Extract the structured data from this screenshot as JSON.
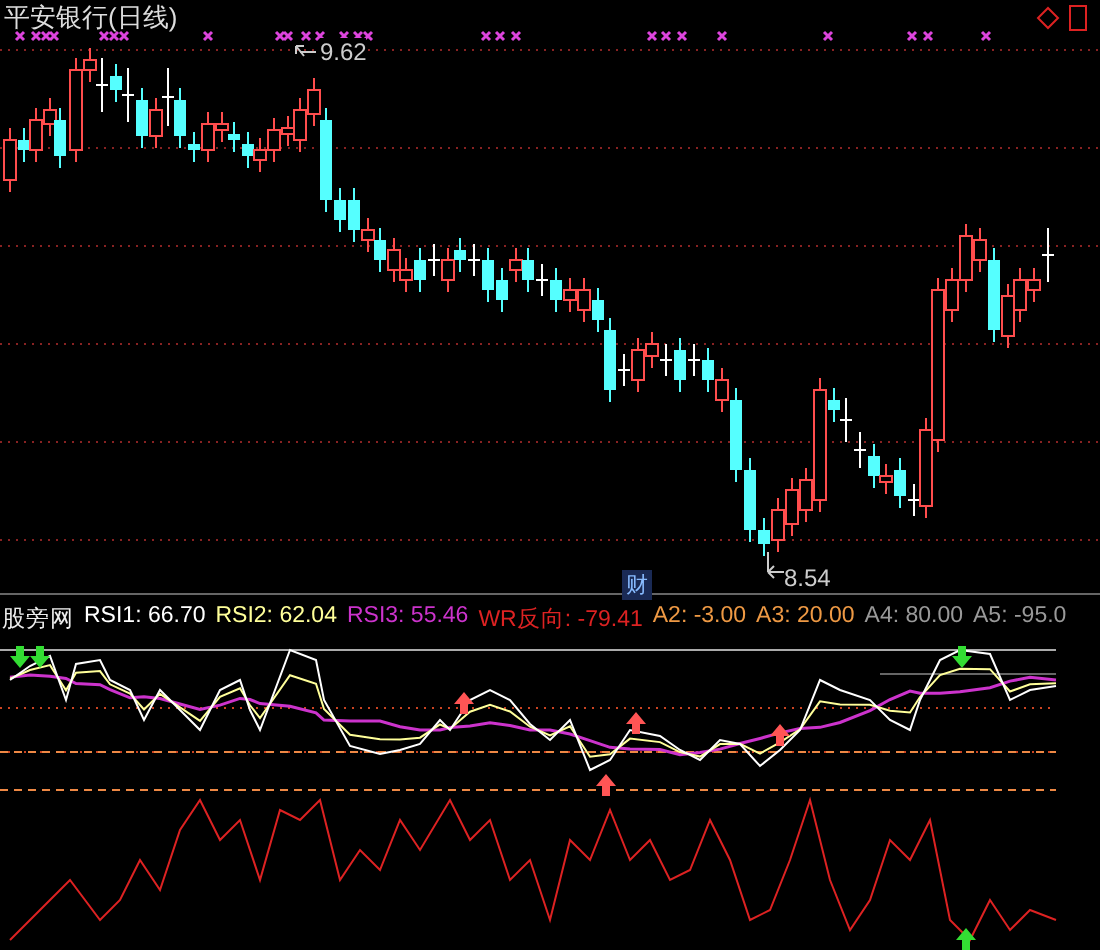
{
  "title": "平安银行(日线)",
  "price_labels": [
    {
      "text": "9.62",
      "kind": "high"
    },
    {
      "text": "8.54",
      "kind": "low"
    }
  ],
  "marker": "财",
  "indicator": {
    "name": "股旁网",
    "values": [
      {
        "text": "RSI1: 66.70",
        "color": "#ffffff"
      },
      {
        "text": "RSI2: 62.04",
        "color": "#ffff99"
      },
      {
        "text": "RSI3: 55.46",
        "color": "#cc33cc"
      },
      {
        "text": "WR反向: -79.41",
        "color": "#dd2222"
      },
      {
        "text": "A2: -3.00",
        "color": "#ee9944"
      },
      {
        "text": "A3: 20.00",
        "color": "#ee9944"
      },
      {
        "text": "A4: 80.00",
        "color": "#999999"
      },
      {
        "text": "A5: -95.0",
        "color": "#999999"
      }
    ]
  }
}
